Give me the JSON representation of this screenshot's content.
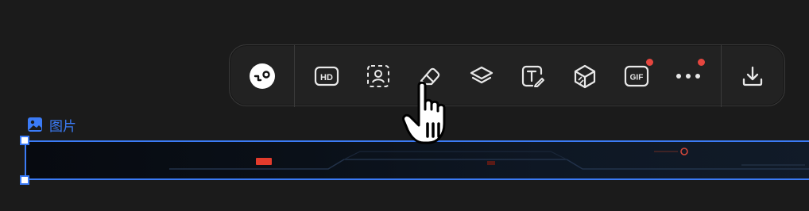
{
  "toolbar": {
    "tools": [
      {
        "name": "logo-tool",
        "icon": "lo-logo-icon"
      },
      {
        "name": "hd-tool",
        "icon": "hd-icon",
        "label": "HD"
      },
      {
        "name": "portrait-cutout-tool",
        "icon": "person-select-icon"
      },
      {
        "name": "eraser-tool",
        "icon": "eraser-icon"
      },
      {
        "name": "layers-tool",
        "icon": "layers-icon"
      },
      {
        "name": "text-tool",
        "icon": "text-edit-icon"
      },
      {
        "name": "3d-tool",
        "icon": "cube-icon"
      },
      {
        "name": "gif-tool",
        "icon": "gif-icon",
        "label": "GIF",
        "badge": true
      },
      {
        "name": "more-tool",
        "icon": "more-icon",
        "badge": true
      },
      {
        "name": "download-tool",
        "icon": "download-icon"
      }
    ],
    "accent": "#3b7bf6",
    "badge_color": "#e5463f"
  },
  "selection": {
    "label": "图片",
    "icon": "image-icon"
  },
  "cursor": {
    "icon": "hand-pointer-icon"
  }
}
